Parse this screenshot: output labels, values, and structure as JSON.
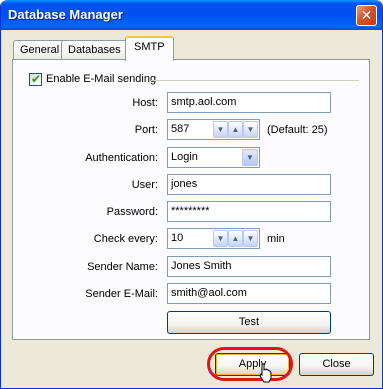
{
  "window": {
    "title": "Database Manager",
    "close_glyph": "✕"
  },
  "tabs": [
    {
      "label": "General",
      "active": false
    },
    {
      "label": "Databases",
      "active": false
    },
    {
      "label": "SMTP",
      "active": true
    }
  ],
  "smtp": {
    "enable_label": "Enable E-Mail sending",
    "enable_checked": true,
    "host_label": "Host:",
    "host_value": "smtp.aol.com",
    "port_label": "Port:",
    "port_value": "587",
    "port_default_note": "(Default: 25)",
    "auth_label": "Authentication:",
    "auth_value": "Login",
    "user_label": "User:",
    "user_value": "jones",
    "password_label": "Password:",
    "password_value": "*********",
    "check_label": "Check every:",
    "check_value": "10",
    "check_unit": "min",
    "sender_name_label": "Sender Name:",
    "sender_name_value": "Jones Smith",
    "sender_email_label": "Sender E-Mail:",
    "sender_email_value": "smith@aol.com",
    "test_label": "Test"
  },
  "footer": {
    "apply_label": "Apply",
    "close_label": "Close"
  },
  "colors": {
    "title_bar": "#0053ee",
    "highlight_ring": "#e01414",
    "active_tab_accent": "#ffc73c"
  }
}
